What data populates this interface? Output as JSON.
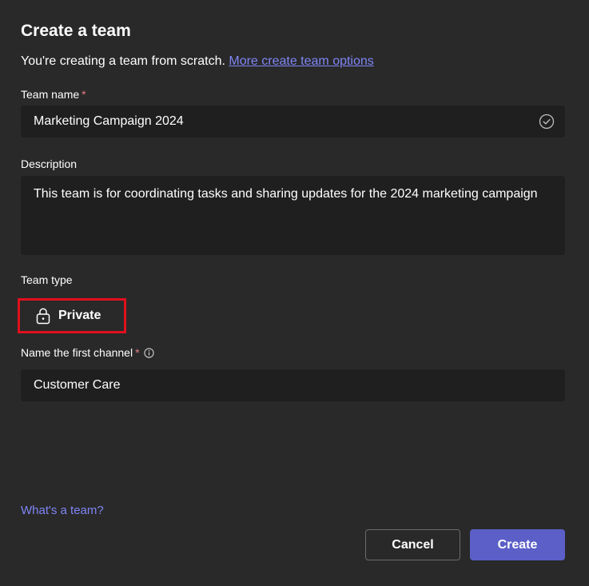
{
  "dialog": {
    "title": "Create a team",
    "subtitle_text": "You're creating a team from scratch. ",
    "subtitle_link": "More create team options"
  },
  "team_name": {
    "label": "Team name",
    "required_mark": "*",
    "value": "Marketing Campaign 2024",
    "status_icon": "check-circle-icon"
  },
  "description": {
    "label": "Description",
    "value": "This team is for coordinating tasks and sharing updates for the 2024 marketing campaign"
  },
  "team_type": {
    "label": "Team type",
    "selected": "Private",
    "icon": "lock-icon",
    "highlight_color": "#e0101e"
  },
  "first_channel": {
    "label": "Name the first channel",
    "required_mark": "*",
    "info_icon": "info-icon",
    "value": "Customer Care"
  },
  "footer": {
    "help_link": "What's a team?",
    "cancel_label": "Cancel",
    "create_label": "Create"
  },
  "colors": {
    "background": "#292929",
    "field_background": "#1f1f1f",
    "link": "#7f85f5",
    "primary": "#5b5fc7",
    "required": "#e37d80"
  }
}
